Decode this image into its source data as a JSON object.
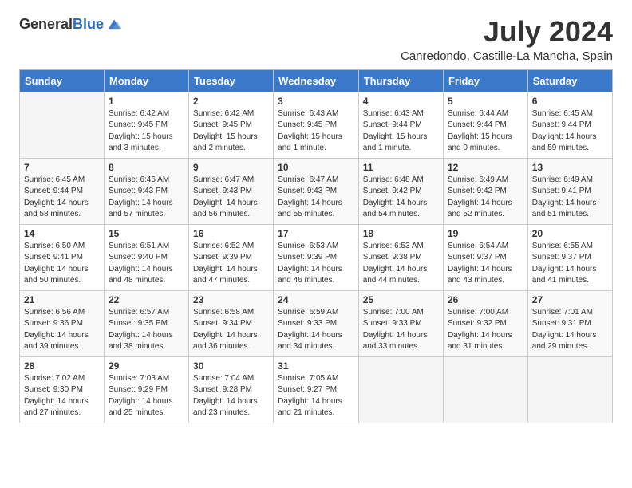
{
  "header": {
    "logo_general": "General",
    "logo_blue": "Blue",
    "month_title": "July 2024",
    "location": "Canredondo, Castille-La Mancha, Spain"
  },
  "days_of_week": [
    "Sunday",
    "Monday",
    "Tuesday",
    "Wednesday",
    "Thursday",
    "Friday",
    "Saturday"
  ],
  "weeks": [
    [
      {
        "day": "",
        "sunrise": "",
        "sunset": "",
        "daylight": ""
      },
      {
        "day": "1",
        "sunrise": "Sunrise: 6:42 AM",
        "sunset": "Sunset: 9:45 PM",
        "daylight": "Daylight: 15 hours and 3 minutes."
      },
      {
        "day": "2",
        "sunrise": "Sunrise: 6:42 AM",
        "sunset": "Sunset: 9:45 PM",
        "daylight": "Daylight: 15 hours and 2 minutes."
      },
      {
        "day": "3",
        "sunrise": "Sunrise: 6:43 AM",
        "sunset": "Sunset: 9:45 PM",
        "daylight": "Daylight: 15 hours and 1 minute."
      },
      {
        "day": "4",
        "sunrise": "Sunrise: 6:43 AM",
        "sunset": "Sunset: 9:44 PM",
        "daylight": "Daylight: 15 hours and 1 minute."
      },
      {
        "day": "5",
        "sunrise": "Sunrise: 6:44 AM",
        "sunset": "Sunset: 9:44 PM",
        "daylight": "Daylight: 15 hours and 0 minutes."
      },
      {
        "day": "6",
        "sunrise": "Sunrise: 6:45 AM",
        "sunset": "Sunset: 9:44 PM",
        "daylight": "Daylight: 14 hours and 59 minutes."
      }
    ],
    [
      {
        "day": "7",
        "sunrise": "Sunrise: 6:45 AM",
        "sunset": "Sunset: 9:44 PM",
        "daylight": "Daylight: 14 hours and 58 minutes."
      },
      {
        "day": "8",
        "sunrise": "Sunrise: 6:46 AM",
        "sunset": "Sunset: 9:43 PM",
        "daylight": "Daylight: 14 hours and 57 minutes."
      },
      {
        "day": "9",
        "sunrise": "Sunrise: 6:47 AM",
        "sunset": "Sunset: 9:43 PM",
        "daylight": "Daylight: 14 hours and 56 minutes."
      },
      {
        "day": "10",
        "sunrise": "Sunrise: 6:47 AM",
        "sunset": "Sunset: 9:43 PM",
        "daylight": "Daylight: 14 hours and 55 minutes."
      },
      {
        "day": "11",
        "sunrise": "Sunrise: 6:48 AM",
        "sunset": "Sunset: 9:42 PM",
        "daylight": "Daylight: 14 hours and 54 minutes."
      },
      {
        "day": "12",
        "sunrise": "Sunrise: 6:49 AM",
        "sunset": "Sunset: 9:42 PM",
        "daylight": "Daylight: 14 hours and 52 minutes."
      },
      {
        "day": "13",
        "sunrise": "Sunrise: 6:49 AM",
        "sunset": "Sunset: 9:41 PM",
        "daylight": "Daylight: 14 hours and 51 minutes."
      }
    ],
    [
      {
        "day": "14",
        "sunrise": "Sunrise: 6:50 AM",
        "sunset": "Sunset: 9:41 PM",
        "daylight": "Daylight: 14 hours and 50 minutes."
      },
      {
        "day": "15",
        "sunrise": "Sunrise: 6:51 AM",
        "sunset": "Sunset: 9:40 PM",
        "daylight": "Daylight: 14 hours and 48 minutes."
      },
      {
        "day": "16",
        "sunrise": "Sunrise: 6:52 AM",
        "sunset": "Sunset: 9:39 PM",
        "daylight": "Daylight: 14 hours and 47 minutes."
      },
      {
        "day": "17",
        "sunrise": "Sunrise: 6:53 AM",
        "sunset": "Sunset: 9:39 PM",
        "daylight": "Daylight: 14 hours and 46 minutes."
      },
      {
        "day": "18",
        "sunrise": "Sunrise: 6:53 AM",
        "sunset": "Sunset: 9:38 PM",
        "daylight": "Daylight: 14 hours and 44 minutes."
      },
      {
        "day": "19",
        "sunrise": "Sunrise: 6:54 AM",
        "sunset": "Sunset: 9:37 PM",
        "daylight": "Daylight: 14 hours and 43 minutes."
      },
      {
        "day": "20",
        "sunrise": "Sunrise: 6:55 AM",
        "sunset": "Sunset: 9:37 PM",
        "daylight": "Daylight: 14 hours and 41 minutes."
      }
    ],
    [
      {
        "day": "21",
        "sunrise": "Sunrise: 6:56 AM",
        "sunset": "Sunset: 9:36 PM",
        "daylight": "Daylight: 14 hours and 39 minutes."
      },
      {
        "day": "22",
        "sunrise": "Sunrise: 6:57 AM",
        "sunset": "Sunset: 9:35 PM",
        "daylight": "Daylight: 14 hours and 38 minutes."
      },
      {
        "day": "23",
        "sunrise": "Sunrise: 6:58 AM",
        "sunset": "Sunset: 9:34 PM",
        "daylight": "Daylight: 14 hours and 36 minutes."
      },
      {
        "day": "24",
        "sunrise": "Sunrise: 6:59 AM",
        "sunset": "Sunset: 9:33 PM",
        "daylight": "Daylight: 14 hours and 34 minutes."
      },
      {
        "day": "25",
        "sunrise": "Sunrise: 7:00 AM",
        "sunset": "Sunset: 9:33 PM",
        "daylight": "Daylight: 14 hours and 33 minutes."
      },
      {
        "day": "26",
        "sunrise": "Sunrise: 7:00 AM",
        "sunset": "Sunset: 9:32 PM",
        "daylight": "Daylight: 14 hours and 31 minutes."
      },
      {
        "day": "27",
        "sunrise": "Sunrise: 7:01 AM",
        "sunset": "Sunset: 9:31 PM",
        "daylight": "Daylight: 14 hours and 29 minutes."
      }
    ],
    [
      {
        "day": "28",
        "sunrise": "Sunrise: 7:02 AM",
        "sunset": "Sunset: 9:30 PM",
        "daylight": "Daylight: 14 hours and 27 minutes."
      },
      {
        "day": "29",
        "sunrise": "Sunrise: 7:03 AM",
        "sunset": "Sunset: 9:29 PM",
        "daylight": "Daylight: 14 hours and 25 minutes."
      },
      {
        "day": "30",
        "sunrise": "Sunrise: 7:04 AM",
        "sunset": "Sunset: 9:28 PM",
        "daylight": "Daylight: 14 hours and 23 minutes."
      },
      {
        "day": "31",
        "sunrise": "Sunrise: 7:05 AM",
        "sunset": "Sunset: 9:27 PM",
        "daylight": "Daylight: 14 hours and 21 minutes."
      },
      {
        "day": "",
        "sunrise": "",
        "sunset": "",
        "daylight": ""
      },
      {
        "day": "",
        "sunrise": "",
        "sunset": "",
        "daylight": ""
      },
      {
        "day": "",
        "sunrise": "",
        "sunset": "",
        "daylight": ""
      }
    ]
  ]
}
